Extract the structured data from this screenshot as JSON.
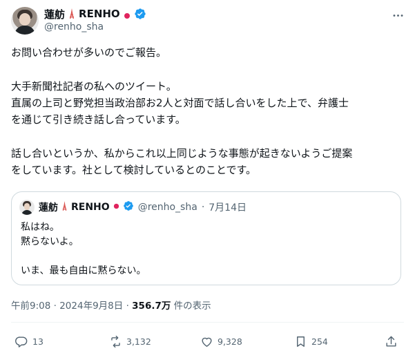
{
  "author": {
    "display_name": "蓮舫",
    "display_name_suffix": "RENHO",
    "handle": "@renho_sha"
  },
  "tweet": {
    "lines": [
      "お問い合わせが多いのでご報告。",
      "大手新聞社記者の私へのツイート。",
      "直属の上司と野党担当政治部お2人と対面で話し合いをした上で、弁護士",
      "を通じて引き続き話し合っています。",
      "話し合いというか、私からこれ以上同じような事態が起きないようご提案",
      "をしています。社として検討しているとのことです。"
    ]
  },
  "quoted": {
    "display_name": "蓮舫",
    "display_name_suffix": "RENHO",
    "handle": "@renho_sha",
    "date": "7月14日",
    "separator": "·",
    "lines": [
      "私はね。",
      "黙らないよ。",
      "いま、最も自由に黙らない。"
    ]
  },
  "meta": {
    "time": "午前9:08",
    "separator1": "·",
    "date": "2024年9月8日",
    "separator2": "·",
    "views": "356.7万",
    "views_label": "件の表示"
  },
  "actions": {
    "reply_count": "13",
    "retweet_count": "3,132",
    "like_count": "9,328",
    "bookmark_count": "254"
  },
  "colors": {
    "verified": "#1d9bf0",
    "secondary_text": "#536471",
    "border": "#cfd9de",
    "flag_red": "#e0245e",
    "tower": "#d9534f"
  },
  "icons": [
    "tokyo-tower-icon",
    "japan-flag-icon",
    "verified-badge-icon",
    "more-icon",
    "reply-icon",
    "retweet-icon",
    "like-icon",
    "bookmark-icon",
    "share-icon"
  ]
}
